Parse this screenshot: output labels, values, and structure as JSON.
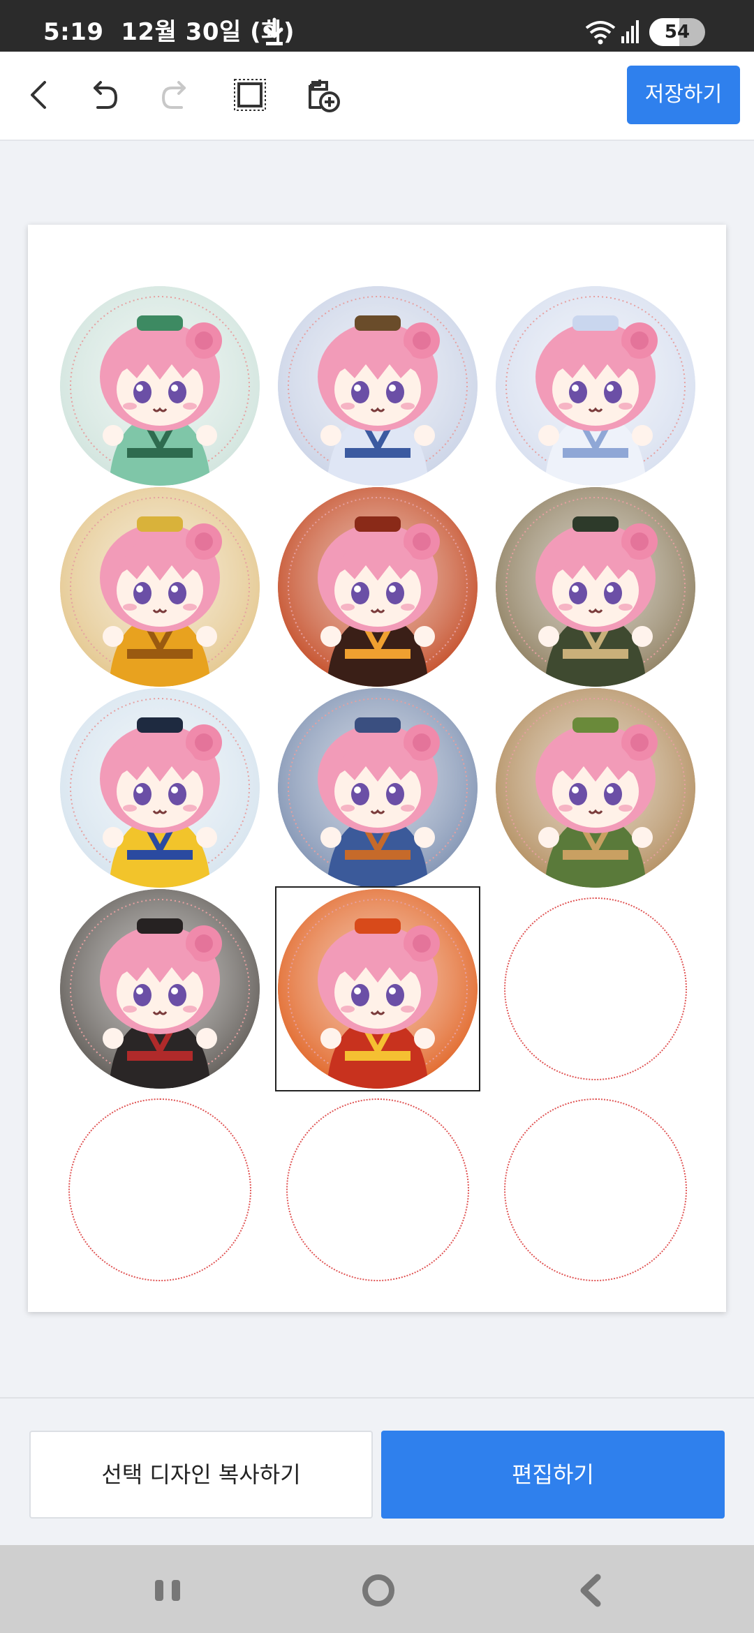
{
  "status_bar": {
    "time": "5:19",
    "date": "12월 30일 (화)",
    "battery_level": "54",
    "battery_fraction": 0.54,
    "icons": [
      "download-icon",
      "wifi-icon",
      "signal-icon",
      "battery-icon"
    ]
  },
  "toolbar": {
    "save_label": "저장하기",
    "icons": [
      "back-icon",
      "undo-icon",
      "redo-icon",
      "crop-icon",
      "add-image-icon"
    ]
  },
  "canvas": {
    "selected_index": 10,
    "stickers": [
      {
        "theme": "jade-scholar",
        "bg": "#cfe3dc",
        "robe": "#7fc6a8",
        "accent": "#2e6b4f",
        "hat": "#3d8a62"
      },
      {
        "theme": "taoist-gourd",
        "bg": "#c9d2e6",
        "robe": "#dfe6f5",
        "accent": "#3b5aa0",
        "hat": "#6a4c2a"
      },
      {
        "theme": "snow-sword",
        "bg": "#d6deef",
        "robe": "#eef2fa",
        "accent": "#8fa7d6",
        "hat": "#c9d6ee"
      },
      {
        "theme": "golden-monk",
        "bg": "#e3c58a",
        "robe": "#e8a21f",
        "accent": "#9a5a10",
        "hat": "#d9b23a"
      },
      {
        "theme": "demon-lord",
        "bg": "#c2461f",
        "robe": "#3a1f17",
        "accent": "#f0a030",
        "hat": "#8a2a18"
      },
      {
        "theme": "wandering-scribe",
        "bg": "#8a7a5a",
        "robe": "#3f4a30",
        "accent": "#c9b07a",
        "hat": "#2d3a2a"
      },
      {
        "theme": "yin-yang-taoist",
        "bg": "#d5e3ee",
        "robe": "#f2c42b",
        "accent": "#2a4aa0",
        "hat": "#1e2a40"
      },
      {
        "theme": "blue-warrior",
        "bg": "#7c8fb0",
        "robe": "#3b5a9a",
        "accent": "#c66a2a",
        "hat": "#3a4f80"
      },
      {
        "theme": "forest-bandit",
        "bg": "#b08a5a",
        "robe": "#5a7a3a",
        "accent": "#c9a062",
        "hat": "#6a8a3a"
      },
      {
        "theme": "black-assassin",
        "bg": "#5a5550",
        "robe": "#2a2626",
        "accent": "#b02a2a",
        "hat": "#262222"
      },
      {
        "theme": "fire-general",
        "bg": "#e0601f",
        "robe": "#c8321e",
        "accent": "#f5c032",
        "hat": "#d84a1a"
      }
    ],
    "empty_slots": 4
  },
  "actions": {
    "copy_label": "선택 디자인 복사하기",
    "edit_label": "편집하기"
  },
  "nav_bar": {
    "icons": [
      "recents-icon",
      "home-icon",
      "back-nav-icon"
    ]
  }
}
